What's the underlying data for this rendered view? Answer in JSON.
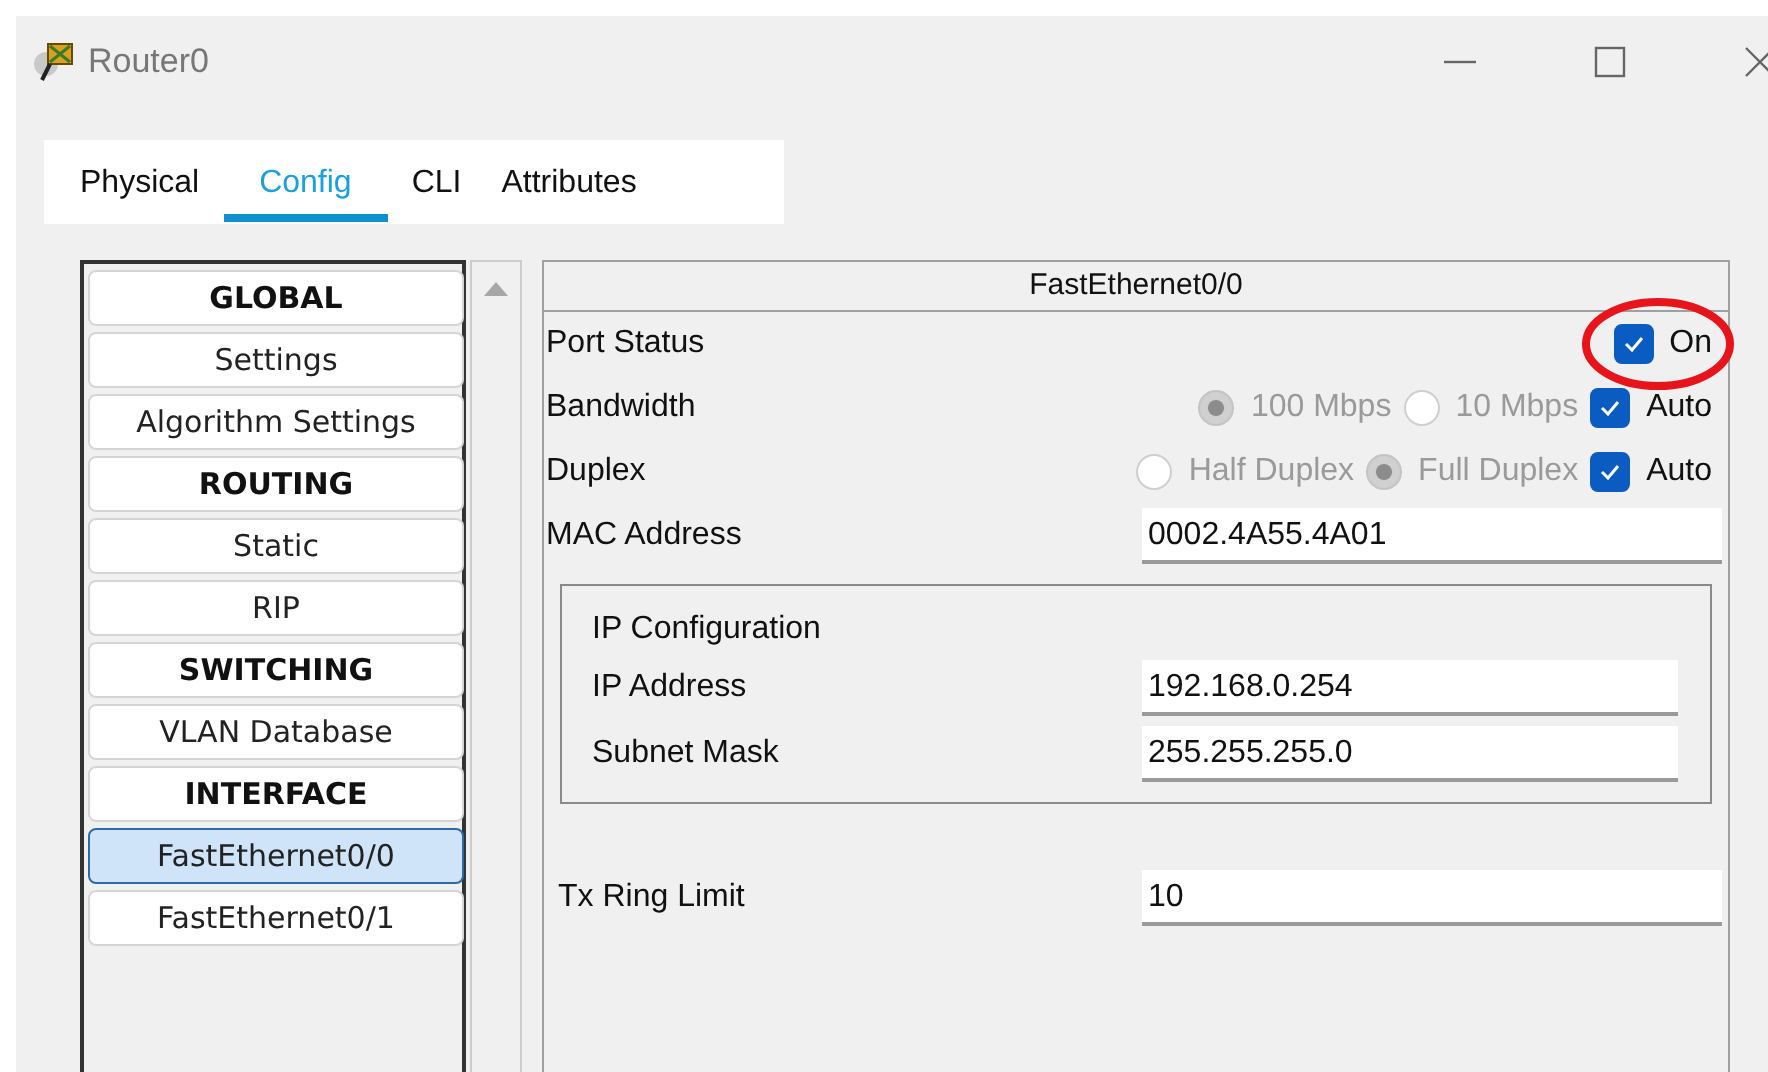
{
  "window": {
    "title": "Router0"
  },
  "tabs": [
    {
      "label": "Physical",
      "selected": false
    },
    {
      "label": "Config",
      "selected": true
    },
    {
      "label": "CLI",
      "selected": false
    },
    {
      "label": "Attributes",
      "selected": false
    }
  ],
  "sidebar": {
    "items": [
      {
        "label": "GLOBAL",
        "kind": "header",
        "selected": false
      },
      {
        "label": "Settings",
        "kind": "item",
        "selected": false
      },
      {
        "label": "Algorithm Settings",
        "kind": "item",
        "selected": false
      },
      {
        "label": "ROUTING",
        "kind": "header",
        "selected": false
      },
      {
        "label": "Static",
        "kind": "item",
        "selected": false
      },
      {
        "label": "RIP",
        "kind": "item",
        "selected": false
      },
      {
        "label": "SWITCHING",
        "kind": "header",
        "selected": false
      },
      {
        "label": "VLAN Database",
        "kind": "item",
        "selected": false
      },
      {
        "label": "INTERFACE",
        "kind": "header",
        "selected": false
      },
      {
        "label": "FastEthernet0/0",
        "kind": "item",
        "selected": true
      },
      {
        "label": "FastEthernet0/1",
        "kind": "item",
        "selected": false
      }
    ]
  },
  "panel": {
    "title": "FastEthernet0/0",
    "rows": [
      {
        "kind": "toggle",
        "label": "Port Status",
        "check": {
          "label": "On",
          "checked": true
        }
      },
      {
        "kind": "choice",
        "label": "Bandwidth",
        "options": [
          {
            "label": "100 Mbps",
            "selected": true,
            "disabled": true
          },
          {
            "label": "10 Mbps",
            "selected": false,
            "disabled": true
          }
        ],
        "check": {
          "label": "Auto",
          "checked": true
        }
      },
      {
        "kind": "choice",
        "label": "Duplex",
        "options": [
          {
            "label": "Half Duplex",
            "selected": false,
            "disabled": true
          },
          {
            "label": "Full Duplex",
            "selected": true,
            "disabled": true
          }
        ],
        "check": {
          "label": "Auto",
          "checked": true
        }
      },
      {
        "kind": "field",
        "label": "MAC Address",
        "value": "0002.4A55.4A01"
      }
    ],
    "ip_config": {
      "title": "IP Configuration",
      "fields": [
        {
          "label": "IP Address",
          "value": "192.168.0.254"
        },
        {
          "label": "Subnet Mask",
          "value": "255.255.255.0"
        }
      ]
    },
    "tx_ring_limit": {
      "label": "Tx Ring Limit",
      "value": "10"
    }
  }
}
